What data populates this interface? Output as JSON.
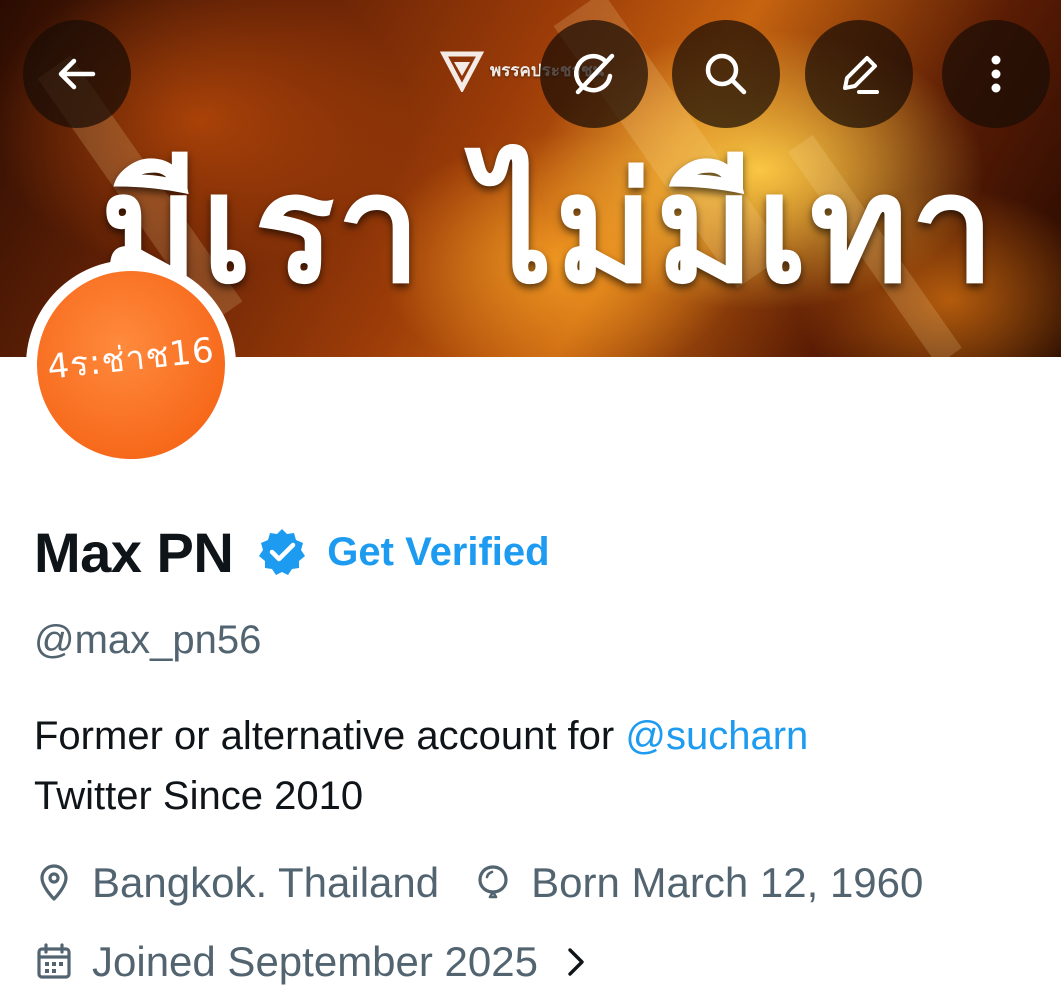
{
  "header": {
    "banner_title": "มีเรา ไม่มีเทา",
    "party_logo_text": "พรรคประชาชน",
    "buttons": {
      "back": "back-arrow-icon",
      "grok": "grok-icon",
      "search": "search-icon",
      "edit": "edit-icon",
      "more": "more-vertical-icon"
    }
  },
  "profile": {
    "avatar_text": "4ร:ช่าช16",
    "display_name": "Max PN",
    "get_verified_label": "Get Verified",
    "handle": "@max_pn56",
    "bio_line1_prefix": "Former or alternative account for ",
    "bio_mention": "@sucharn",
    "bio_line2": "Twitter Since 2010",
    "location": "Bangkok.  Thailand",
    "birthday": "Born March 12, 1960",
    "joined": "Joined September 2025"
  },
  "colors": {
    "accent": "#1d9bf0",
    "text_primary": "#0f1419",
    "text_secondary": "#536471",
    "avatar_bg": "#f76a1c"
  }
}
